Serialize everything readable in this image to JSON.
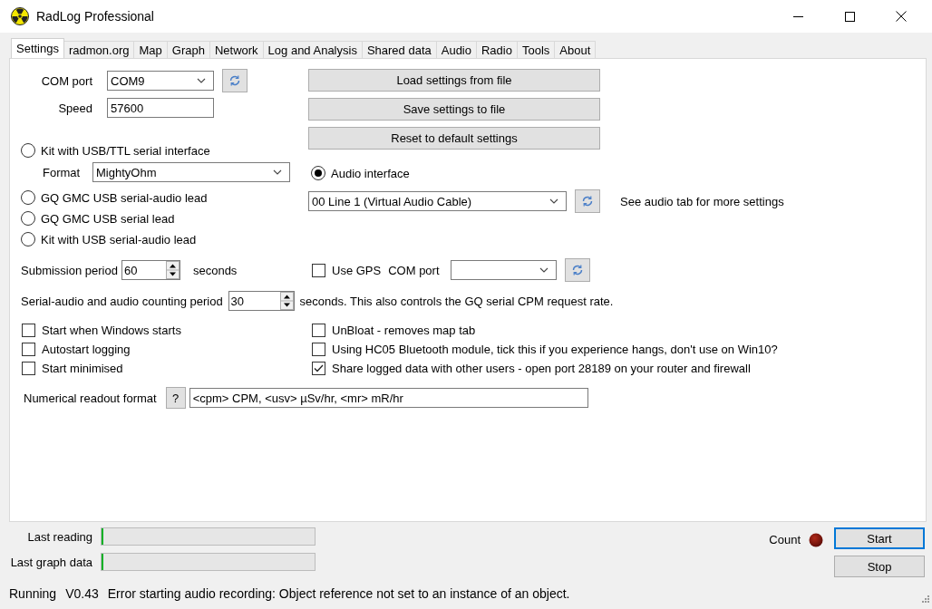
{
  "window": {
    "title": "RadLog Professional"
  },
  "tabs": [
    {
      "label": "Settings",
      "selected": true
    },
    {
      "label": "radmon.org",
      "selected": false
    },
    {
      "label": "Map",
      "selected": false
    },
    {
      "label": "Graph",
      "selected": false
    },
    {
      "label": "Network",
      "selected": false
    },
    {
      "label": "Log and Analysis",
      "selected": false
    },
    {
      "label": "Shared data",
      "selected": false
    },
    {
      "label": "Audio",
      "selected": false
    },
    {
      "label": "Radio",
      "selected": false
    },
    {
      "label": "Tools",
      "selected": false
    },
    {
      "label": "About",
      "selected": false
    }
  ],
  "settings": {
    "com_port": {
      "label": "COM port",
      "value": "COM9"
    },
    "speed": {
      "label": "Speed",
      "value": "57600"
    },
    "file_buttons": [
      "Load settings from file",
      "Save settings to file",
      "Reset to default settings"
    ],
    "interfaces": [
      {
        "label": "Kit with USB/TTL serial interface",
        "selected": false
      },
      {
        "label": "Audio interface",
        "selected": true
      },
      {
        "label": "GQ GMC USB serial-audio lead",
        "selected": false
      },
      {
        "label": "GQ GMC USB serial lead",
        "selected": false
      },
      {
        "label": "Kit with USB serial-audio lead",
        "selected": false
      }
    ],
    "format": {
      "label": "Format",
      "value": "MightyOhm"
    },
    "audio_device": {
      "value": "00 Line 1 (Virtual Audio Cable)",
      "hint": "See audio tab for more settings"
    },
    "submission_period": {
      "label": "Submission period",
      "value": "60",
      "unit": "seconds"
    },
    "gps": {
      "label": "Use GPS",
      "checked": false,
      "port_label": "COM port"
    },
    "counting_period": {
      "label": "Serial-audio and audio counting period",
      "value": "30",
      "unit": "seconds. This also controls the GQ serial CPM request rate."
    },
    "options": [
      {
        "label": "Start when Windows starts",
        "checked": false
      },
      {
        "label": "UnBloat - removes map tab",
        "checked": false
      },
      {
        "label": "Autostart logging",
        "checked": false
      },
      {
        "label": "Using HC05 Bluetooth module, tick this if you experience hangs, don't use on Win10?",
        "checked": false
      },
      {
        "label": "Start minimised",
        "checked": false
      },
      {
        "label": "Share logged data with other users - open port 28189 on your router and firewall",
        "checked": true
      }
    ],
    "readout": {
      "label": "Numerical readout format",
      "help": "?",
      "value": "<cpm> CPM, <usv> µSv/hr, <mr> mR/hr"
    }
  },
  "bottom": {
    "meters": [
      {
        "label": "Last reading",
        "level": 0.01
      },
      {
        "label": "Last graph data",
        "level": 0.01
      }
    ],
    "count_label": "Count",
    "buttons": [
      {
        "label": "Start",
        "default": true
      },
      {
        "label": "Stop",
        "default": false
      }
    ]
  },
  "status_bar": {
    "state": "Running",
    "version": "V0.43",
    "message": "Error starting audio recording: Object reference not set to an instance of an object."
  }
}
